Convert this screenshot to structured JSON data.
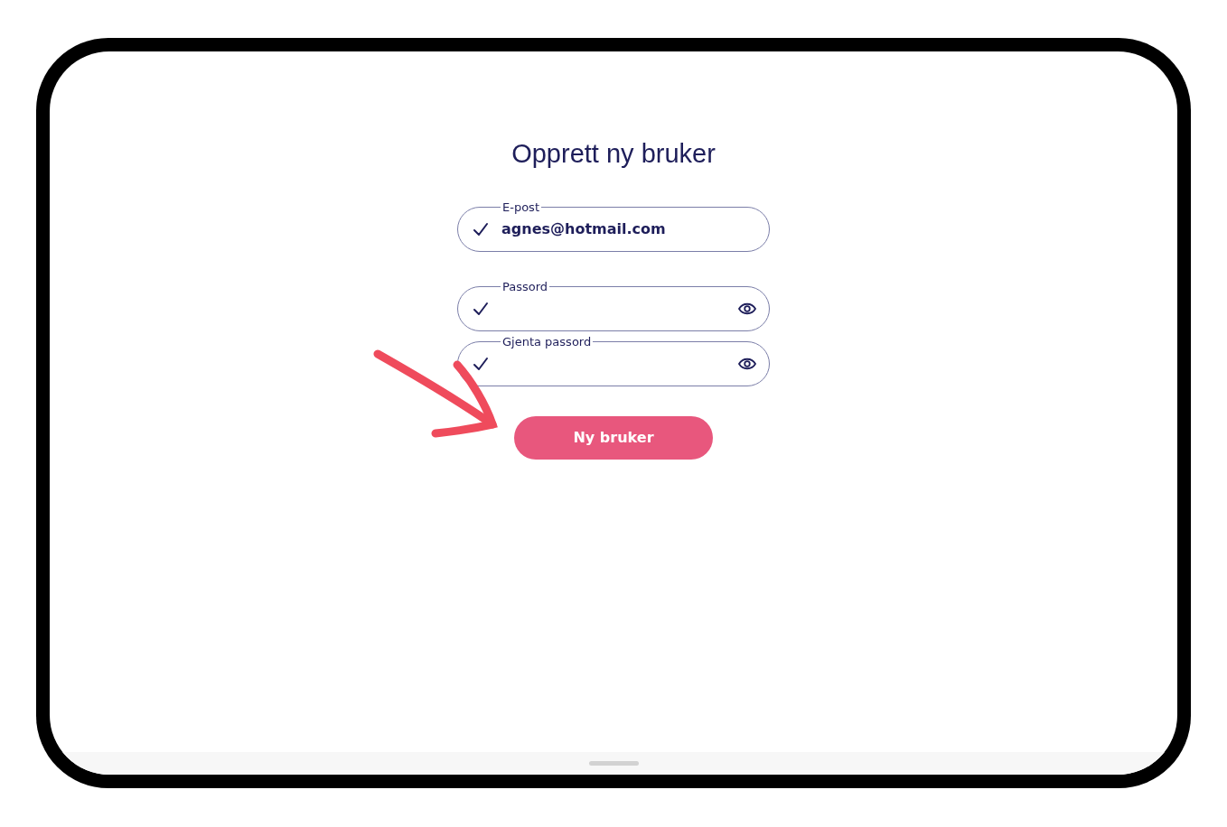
{
  "title": "Opprett ny bruker",
  "fields": [
    {
      "kind": "email",
      "label": "E-post",
      "value": "agnes@hotmail.com",
      "valid": true
    },
    {
      "kind": "password",
      "label": "Passord",
      "valid": true
    },
    {
      "kind": "password",
      "label": "Gjenta passord",
      "valid": true
    }
  ],
  "submit_button": "Ny bruker"
}
